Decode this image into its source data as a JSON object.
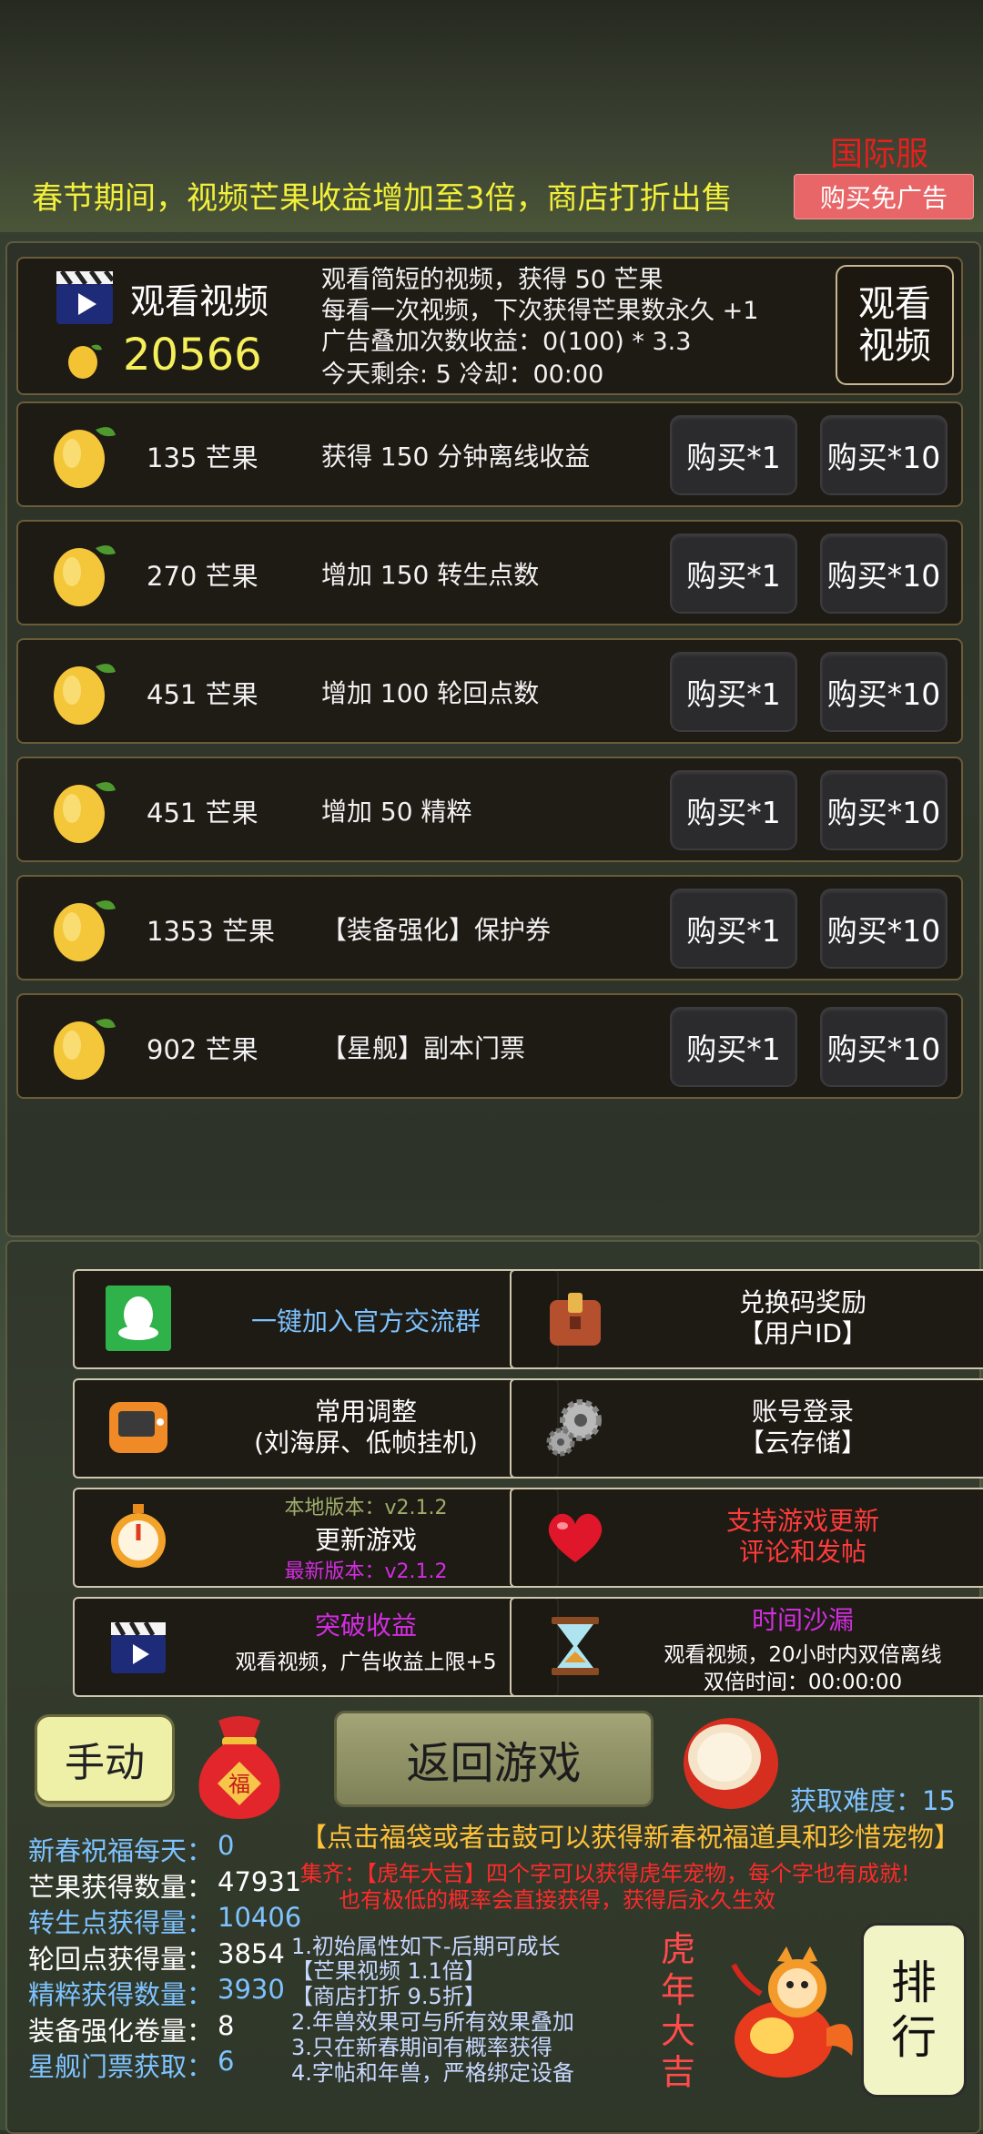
{
  "header": {
    "notice": "春节期间，视频芒果收益增加至3倍，商店打折出售",
    "server_label": "国际服",
    "buy_noads_label": "购买免广告"
  },
  "video": {
    "title": "观看视频",
    "mango_total": "20566",
    "lines": [
      "观看简短的视频，获得 50 芒果",
      "每看一次视频，下次获得芒果数永久 +1",
      "广告叠加次数收益：0(100) * 3.3",
      "今天剩余: 5    冷却：00:00"
    ],
    "button_line1": "观看",
    "button_line2": "视频"
  },
  "shop": {
    "buy1_label": "购买*1",
    "buy10_label": "购买*10",
    "items": [
      {
        "price": "135 芒果",
        "desc": "获得 150 分钟离线收益"
      },
      {
        "price": "270 芒果",
        "desc": "增加 150 转生点数"
      },
      {
        "price": "451 芒果",
        "desc": "增加 100 轮回点数"
      },
      {
        "price": "451 芒果",
        "desc": "增加 50 精粹"
      },
      {
        "price": "1353 芒果",
        "desc": "【装备强化】保护券"
      },
      {
        "price": "902 芒果",
        "desc": "【星舰】副本门票"
      }
    ]
  },
  "functions": {
    "join_group": "一键加入官方交流群",
    "redeem_line1": "兑换码奖励",
    "redeem_line2": "【用户ID】",
    "settings_line1": "常用调整",
    "settings_line2": "(刘海屏、低帧挂机)",
    "login_line1": "账号登录",
    "login_line2": "【云存储】",
    "local_version": "本地版本：v2.1.2",
    "update_game": "更新游戏",
    "latest_version": "最新版本：v2.1.2",
    "support_line1": "支持游戏更新",
    "support_line2": "评论和发帖",
    "breakthrough_title": "突破收益",
    "breakthrough_desc": "观看视频，广告收益上限+5",
    "hourglass_title": "时间沙漏",
    "hourglass_desc": "观看视频，20小时内双倍离线",
    "hourglass_time": "双倍时间：00:00:00"
  },
  "bottom": {
    "manual_label": "手动",
    "fu_char": "福",
    "return_label": "返回游戏",
    "difficulty": "获取难度：15",
    "hint_main": "【点击福袋或者击鼓可以获得新春祝福道具和珍惜宠物】",
    "hint_2": "集齐：【虎年大吉】四个字可以获得虎年宠物，每个字也有成就!",
    "hint_3": "也有极低的概率会直接获得，获得后永久生效",
    "rank_line1": "排",
    "rank_line2": "行",
    "tiger_chars": [
      "虎",
      "年",
      "大",
      "吉"
    ]
  },
  "stats": [
    {
      "label": "新春祝福每天：",
      "value": "0",
      "color": "#7ec3ff"
    },
    {
      "label": "芒果获得数量：",
      "value": "47931",
      "color": "#ffffff"
    },
    {
      "label": "转生点获得量：",
      "value": "10406",
      "color": "#7ec3ff"
    },
    {
      "label": "轮回点获得量：",
      "value": "3854",
      "color": "#ffffff"
    },
    {
      "label": "精粹获得数量：",
      "value": "3930",
      "color": "#7ec3ff"
    },
    {
      "label": "装备强化卷量：",
      "value": "8",
      "color": "#ffffff"
    },
    {
      "label": "星舰门票获取：",
      "value": "6",
      "color": "#7ec3ff"
    }
  ],
  "notes": [
    "1.初始属性如下-后期可成长",
    "【芒果视频 1.1倍】",
    "【商店打折 9.5折】",
    "2.年兽效果可与所有效果叠加",
    "3.只在新春期间有概率获得",
    "4.字帖和年兽，严格绑定设备"
  ],
  "colors": {
    "accent_yellow": "#f2f03a",
    "red": "#e5201f",
    "blue": "#7ec3ff",
    "magenta": "#d22ee0"
  }
}
